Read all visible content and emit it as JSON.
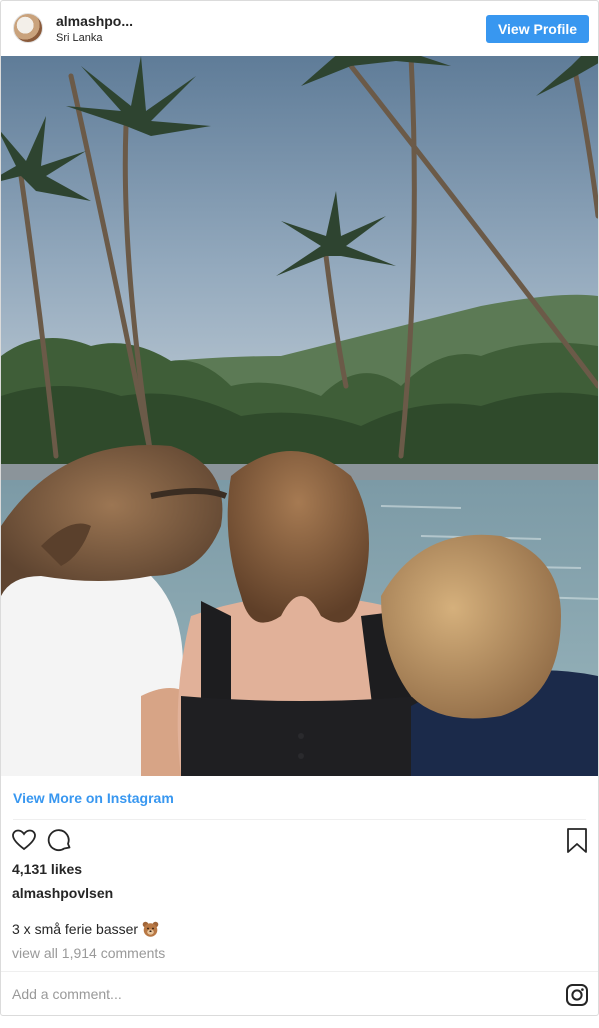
{
  "header": {
    "username": "almashpo...",
    "location": "Sri Lanka",
    "view_profile_label": "View Profile"
  },
  "post": {
    "view_more_label": "View More on Instagram",
    "likes": "4,131 likes",
    "author": "almashpovlsen",
    "caption_text": "3 x små ferie basser",
    "caption_emoji": "bear-face-icon",
    "view_comments_label": "view all 1,914 comments",
    "add_comment_placeholder": "Add a comment..."
  },
  "colors": {
    "accent": "#3897f0",
    "muted_text": "#999999",
    "text": "#262626"
  },
  "icons": {
    "like": "heart-icon",
    "comment": "comment-icon",
    "save": "bookmark-icon",
    "brand": "instagram-icon"
  }
}
